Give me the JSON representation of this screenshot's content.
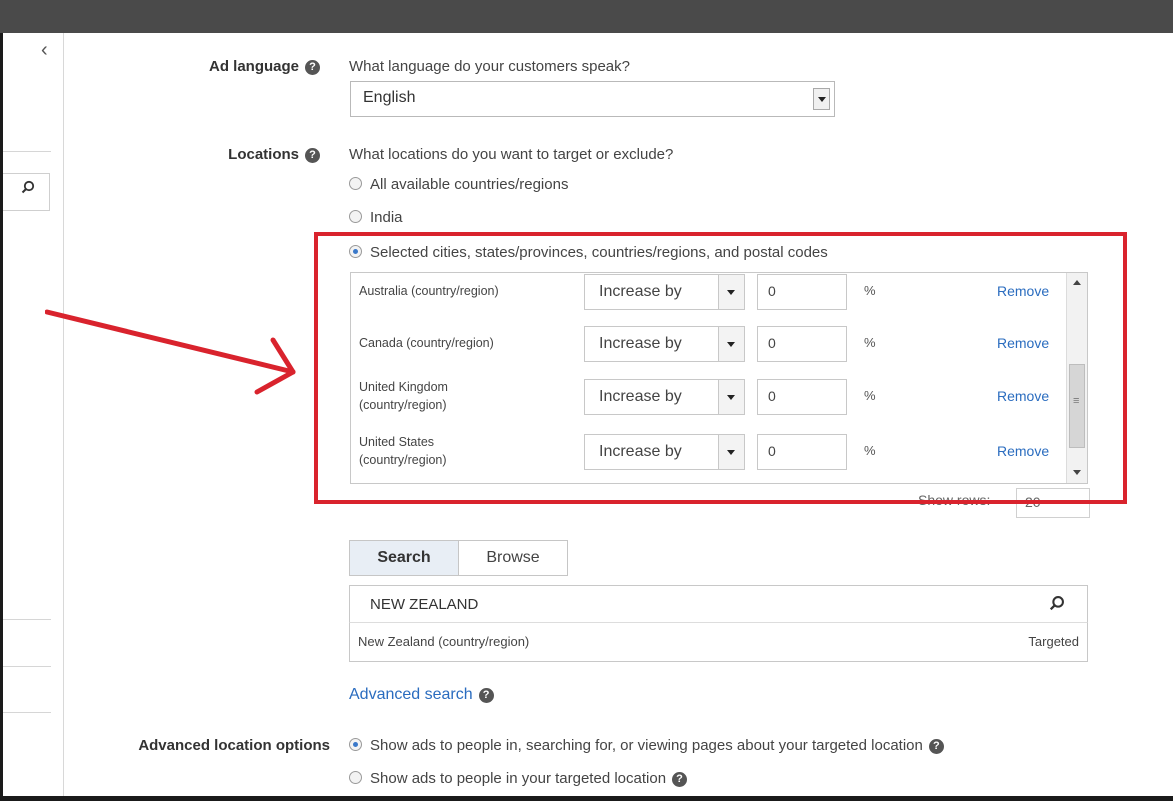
{
  "left_panel": {
    "collapse_label": "‹"
  },
  "ad_language": {
    "label": "Ad language",
    "question": "What language do your customers speak?",
    "selected": "English"
  },
  "locations": {
    "label": "Locations",
    "question": "What locations do you want to target or exclude?",
    "options": [
      {
        "label": "All available countries/regions",
        "checked": false
      },
      {
        "label": "India",
        "checked": false
      },
      {
        "label": "Selected cities, states/provinces, countries/regions, and postal codes",
        "checked": true
      }
    ],
    "rows": [
      {
        "name": "Australia (country/region)",
        "bid_type": "Increase by",
        "value": "0",
        "unit": "%",
        "action": "Remove"
      },
      {
        "name": "Canada (country/region)",
        "bid_type": "Increase by",
        "value": "0",
        "unit": "%",
        "action": "Remove"
      },
      {
        "name": "United Kingdom (country/region)",
        "bid_type": "Increase by",
        "value": "0",
        "unit": "%",
        "action": "Remove"
      },
      {
        "name": "United States (country/region)",
        "bid_type": "Increase by",
        "value": "0",
        "unit": "%",
        "action": "Remove"
      }
    ],
    "show_rows_label": "Show rows:",
    "show_rows_value": "20"
  },
  "search_panel": {
    "tabs": [
      "Search",
      "Browse"
    ],
    "active_tab": "Search",
    "query": "NEW ZEALAND",
    "result_name": "New Zealand (country/region)",
    "result_status": "Targeted",
    "advanced_search": "Advanced search"
  },
  "advanced_location": {
    "label": "Advanced location options",
    "options": [
      {
        "label": "Show ads to people in, searching for, or viewing pages about your targeted location",
        "checked": true
      },
      {
        "label": "Show ads to people in your targeted location",
        "checked": false
      }
    ]
  },
  "colors": {
    "highlight_box": "#d9232d",
    "arrow": "#d9232d",
    "link": "#2a6cbf"
  },
  "icons": [
    "chevron-left-icon",
    "search-icon",
    "help-icon",
    "dropdown-arrow-icon",
    "annotation-arrow"
  ]
}
